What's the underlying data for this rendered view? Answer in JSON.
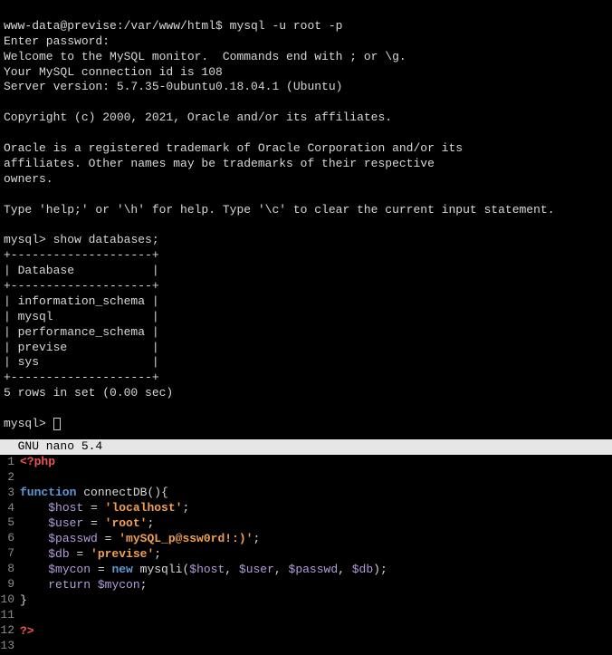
{
  "terminal": {
    "prompt": "www-data@previse:/var/www/html$",
    "command": "mysql -u root -p",
    "enter_password": "Enter password:",
    "welcome": "Welcome to the MySQL monitor.  Commands end with ; or \\g.",
    "conn_id": "Your MySQL connection id is 108",
    "server_ver": "Server version: 5.7.35-0ubuntu0.18.04.1 (Ubuntu)",
    "copyright": "Copyright (c) 2000, 2021, Oracle and/or its affiliates.",
    "trademark1": "Oracle is a registered trademark of Oracle Corporation and/or its",
    "trademark2": "affiliates. Other names may be trademarks of their respective",
    "trademark3": "owners.",
    "help_line": "Type 'help;' or '\\h' for help. Type '\\c' to clear the current input statement.",
    "mysql_prompt": "mysql>",
    "show_db_cmd": "show databases;",
    "table_border_top": "+--------------------+",
    "table_header": "| Database           |",
    "table_border_mid": "+--------------------+",
    "db_row1": "| information_schema |",
    "db_row2": "| mysql              |",
    "db_row3": "| performance_schema |",
    "db_row4": "| previse            |",
    "db_row5": "| sys                |",
    "table_border_bot": "+--------------------+",
    "rows_result": "5 rows in set (0.00 sec)"
  },
  "nano": {
    "header": "  GNU nano 5.4",
    "lines": [
      "1",
      "2",
      "3",
      "4",
      "5",
      "6",
      "7",
      "8",
      "9",
      "10",
      "11",
      "12",
      "13"
    ]
  },
  "php": {
    "open": "<?php",
    "close": "?>",
    "func_kw": "function",
    "func_name": "connectDB",
    "func_sig": "(){",
    "host_var": "$host",
    "host_val": "'localhost'",
    "user_var": "$user",
    "user_val": "'root'",
    "passwd_var": "$passwd",
    "passwd_val": "'mySQL_p@ssw0rd!:)'",
    "db_var": "$db",
    "db_val": "'previse'",
    "mycon_var": "$mycon",
    "new_kw": "new",
    "mysqli": "mysqli",
    "args_open": "(",
    "args_close": ");",
    "comma": ", ",
    "return_kw": "return",
    "eq": " = ",
    "semi": ";",
    "brace_close": "}"
  }
}
